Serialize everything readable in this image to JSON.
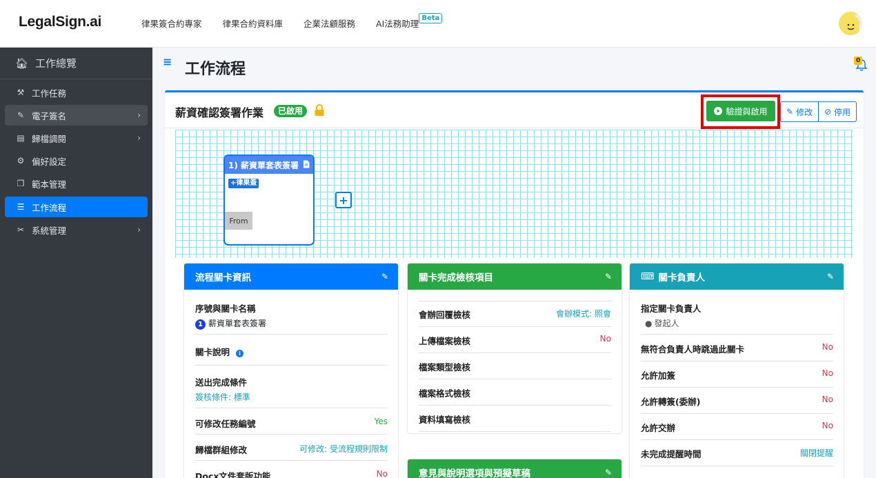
{
  "app": {
    "logo": "LegalSign.ai"
  },
  "nav": {
    "links": [
      "律果簽合約專家",
      "律果合約資料庫",
      "企業法顧服務",
      "AI法務助理"
    ],
    "beta": "Beta"
  },
  "notifications": {
    "count": "0"
  },
  "sidebar": {
    "overview": "工作總覽",
    "items": [
      {
        "label": "工作任務",
        "icon": "handshake-icon"
      },
      {
        "label": "電子簽名",
        "icon": "signature-icon"
      },
      {
        "label": "歸檔調閱",
        "icon": "archive-icon"
      },
      {
        "label": "偏好設定",
        "icon": "user-cog-icon"
      },
      {
        "label": "範本管理",
        "icon": "copy-icon"
      },
      {
        "label": "工作流程",
        "icon": "list-icon"
      },
      {
        "label": "系統管理",
        "icon": "tools-icon"
      }
    ]
  },
  "page": {
    "title": "工作流程"
  },
  "workflow": {
    "title": "薪資確認簽署作業",
    "status": "已啟用",
    "validate_label": "驗證與啟用",
    "edit_label": "修改",
    "disable_label": "停用"
  },
  "node": {
    "title": "1) 薪資單套表簽署",
    "tag": "+律果簽",
    "from": "From"
  },
  "panel_info": {
    "title": "流程關卡資訊",
    "seq_label": "序號與關卡名稱",
    "seq_num": "1",
    "seq_name": "薪資單套表簽署",
    "desc_label": "關卡說明",
    "send_label": "送出完成條件",
    "send_value": "簽核條件: 標準",
    "task_no_label": "可修改任務編號",
    "task_no_value": "Yes",
    "group_label": "歸檔群組修改",
    "group_value": "可修改: 受流程規則限制",
    "docx_label": "Docx文件套版功能",
    "docx_value": "No"
  },
  "panel_check": {
    "title": "關卡完成檢核項目",
    "rows": [
      {
        "label": "會辦回覆檢核",
        "value": "會辦模式: 照會"
      },
      {
        "label": "上傳檔案檢核",
        "value": "No"
      },
      {
        "label": "檔案類型檢核",
        "value": ""
      },
      {
        "label": "檔案格式檢核",
        "value": ""
      },
      {
        "label": "資料填寫檢核",
        "value": ""
      }
    ]
  },
  "panel_opinion": {
    "title": "意見與說明選項與預擬草稿"
  },
  "panel_owner": {
    "title": "關卡負責人",
    "assign_label": "指定關卡負責人",
    "assign_value": "發起人",
    "rows": [
      {
        "label": "無符合負責人時跳過此關卡",
        "value": "No"
      },
      {
        "label": "允許加簽",
        "value": "No"
      },
      {
        "label": "允許轉簽(委辦)",
        "value": "No"
      },
      {
        "label": "允許交辦",
        "value": "No"
      },
      {
        "label": "未完成提醒時間",
        "value": "關閉提醒"
      }
    ]
  }
}
